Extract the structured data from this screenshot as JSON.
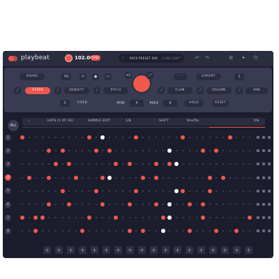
{
  "app": {
    "brand": "playbeat"
  },
  "transport": {
    "bpm": "102.00",
    "badge": "SYNC"
  },
  "preset": {
    "name": "PACK PRESET 006",
    "sub": "1 / 64 / 128",
    "prev": "‹",
    "next": "›"
  },
  "top_icons": [
    "↶",
    "↷",
    "⚙",
    "✦",
    "⏻"
  ],
  "controls": {
    "share": "SHARE",
    "steps": "STEPS",
    "density": "DENSITY",
    "pitch": "PITCH",
    "flam": "FLAM",
    "volume": "VOLUME",
    "pan": "PAN",
    "fixed": "FIXED",
    "min": "MIN",
    "min_val": "4",
    "max": "MAX",
    "max_val": "8",
    "export": "EXPORT",
    "steps_count": "3",
    "hold": "HOLD",
    "reset": "RESET",
    "val_50": "50",
    "val_1": "1",
    "val_x2": "x2"
  },
  "sequencer": {
    "all": "ALL",
    "pattern": "HATS (1 OF 16)",
    "sample_edit": "SAMPLE EDIT",
    "rate": "1/8",
    "shift": "SHIFT",
    "shuffle": "Shuffle",
    "shuffle_val": "0%"
  },
  "tracks": [
    {
      "n": "1",
      "steps": [
        1,
        0,
        0,
        0,
        0,
        0,
        0,
        0,
        0,
        0,
        0,
        0,
        0,
        0,
        0,
        0,
        0,
        0,
        0,
        0,
        0,
        0,
        0,
        0,
        0,
        0,
        0,
        0,
        0,
        0,
        0,
        0,
        0,
        0,
        0,
        0
      ]
    },
    {
      "n": "2",
      "steps": [
        0,
        0,
        0,
        0,
        0,
        0,
        0,
        0,
        0,
        0,
        0,
        0,
        0,
        0,
        0,
        0,
        0,
        0,
        0,
        0,
        0,
        0,
        0,
        0,
        0,
        0,
        0,
        0,
        0,
        0,
        0,
        0,
        0,
        0,
        0,
        0
      ]
    },
    {
      "n": "3",
      "steps": [
        0,
        0,
        0,
        0,
        0,
        0,
        0,
        0,
        0,
        0,
        0,
        0,
        0,
        0,
        0,
        0,
        0,
        0,
        0,
        0,
        0,
        0,
        0,
        0,
        0,
        0,
        0,
        0,
        0,
        0,
        0,
        0,
        0,
        0,
        0,
        0
      ]
    },
    {
      "n": "4",
      "steps": [
        0,
        0,
        0,
        0,
        0,
        0,
        0,
        0,
        0,
        0,
        0,
        0,
        0,
        0,
        0,
        0,
        0,
        0,
        0,
        0,
        0,
        0,
        0,
        0,
        0,
        0,
        0,
        0,
        0,
        0,
        0,
        0,
        0,
        0,
        0,
        0
      ]
    },
    {
      "n": "5",
      "steps": [
        0,
        0,
        0,
        0,
        0,
        0,
        0,
        0,
        0,
        0,
        0,
        0,
        0,
        0,
        0,
        0,
        0,
        0,
        0,
        0,
        0,
        0,
        0,
        0,
        0,
        0,
        0,
        0,
        0,
        0,
        0,
        0,
        0,
        0,
        0,
        0
      ]
    },
    {
      "n": "6",
      "steps": [
        0,
        0,
        0,
        0,
        0,
        0,
        0,
        0,
        0,
        0,
        0,
        0,
        0,
        0,
        0,
        0,
        0,
        0,
        0,
        0,
        0,
        0,
        0,
        0,
        0,
        0,
        0,
        0,
        0,
        0,
        0,
        0,
        0,
        0,
        0,
        0
      ]
    },
    {
      "n": "7",
      "steps": [
        0,
        0,
        0,
        0,
        0,
        0,
        0,
        0,
        0,
        0,
        0,
        0,
        0,
        0,
        0,
        0,
        0,
        0,
        0,
        0,
        0,
        0,
        0,
        0,
        0,
        0,
        0,
        0,
        0,
        0,
        0,
        0,
        0,
        0,
        0,
        0
      ]
    },
    {
      "n": "8",
      "steps": [
        0,
        0,
        0,
        0,
        0,
        0,
        0,
        0,
        0,
        0,
        0,
        0,
        0,
        0,
        0,
        0,
        0,
        0,
        0,
        0,
        0,
        0,
        0,
        0,
        0,
        0,
        0,
        0,
        0,
        0,
        0,
        0,
        0,
        0,
        0,
        0
      ]
    }
  ],
  "active_track": 3,
  "colors": {
    "accent": "#f0584e",
    "bg": "#1c1d2c",
    "panel": "#393b52"
  },
  "add_buttons": [
    "+",
    "+",
    "+",
    "+",
    "+",
    "+",
    "+",
    "+",
    "+",
    "+",
    "+",
    "+",
    "+",
    "+",
    "+",
    "+",
    "+",
    "+"
  ]
}
